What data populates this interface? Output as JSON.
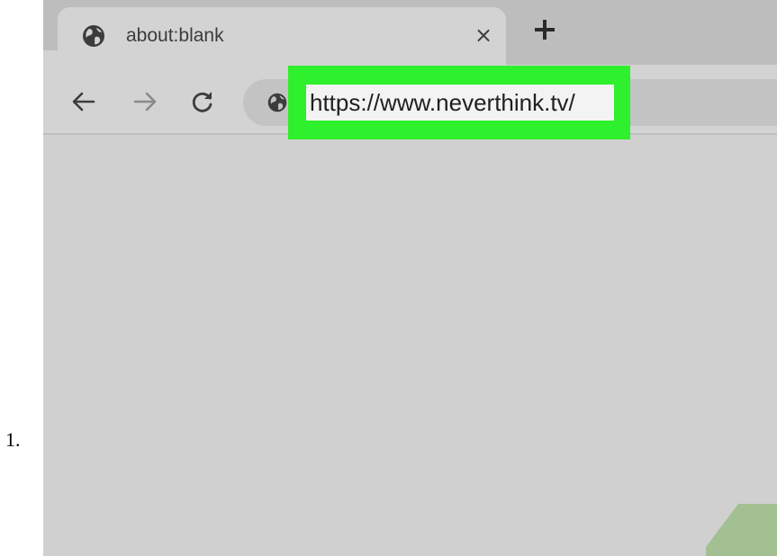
{
  "step": {
    "number": "1."
  },
  "tab": {
    "title": "about:blank",
    "close_glyph": "×",
    "icon": "globe-icon"
  },
  "toolbar": {
    "url": "https://www.neverthink.tv/",
    "icons": [
      "back-arrow-icon",
      "forward-arrow-icon",
      "reload-icon",
      "globe-icon"
    ]
  },
  "colors": {
    "highlight": "#2ef02c",
    "chrome_background": "#d0d0d0",
    "tab_strip": "#bdbdbd",
    "omnibox": "#c3c3c3",
    "accent_green": "#a3c092"
  }
}
